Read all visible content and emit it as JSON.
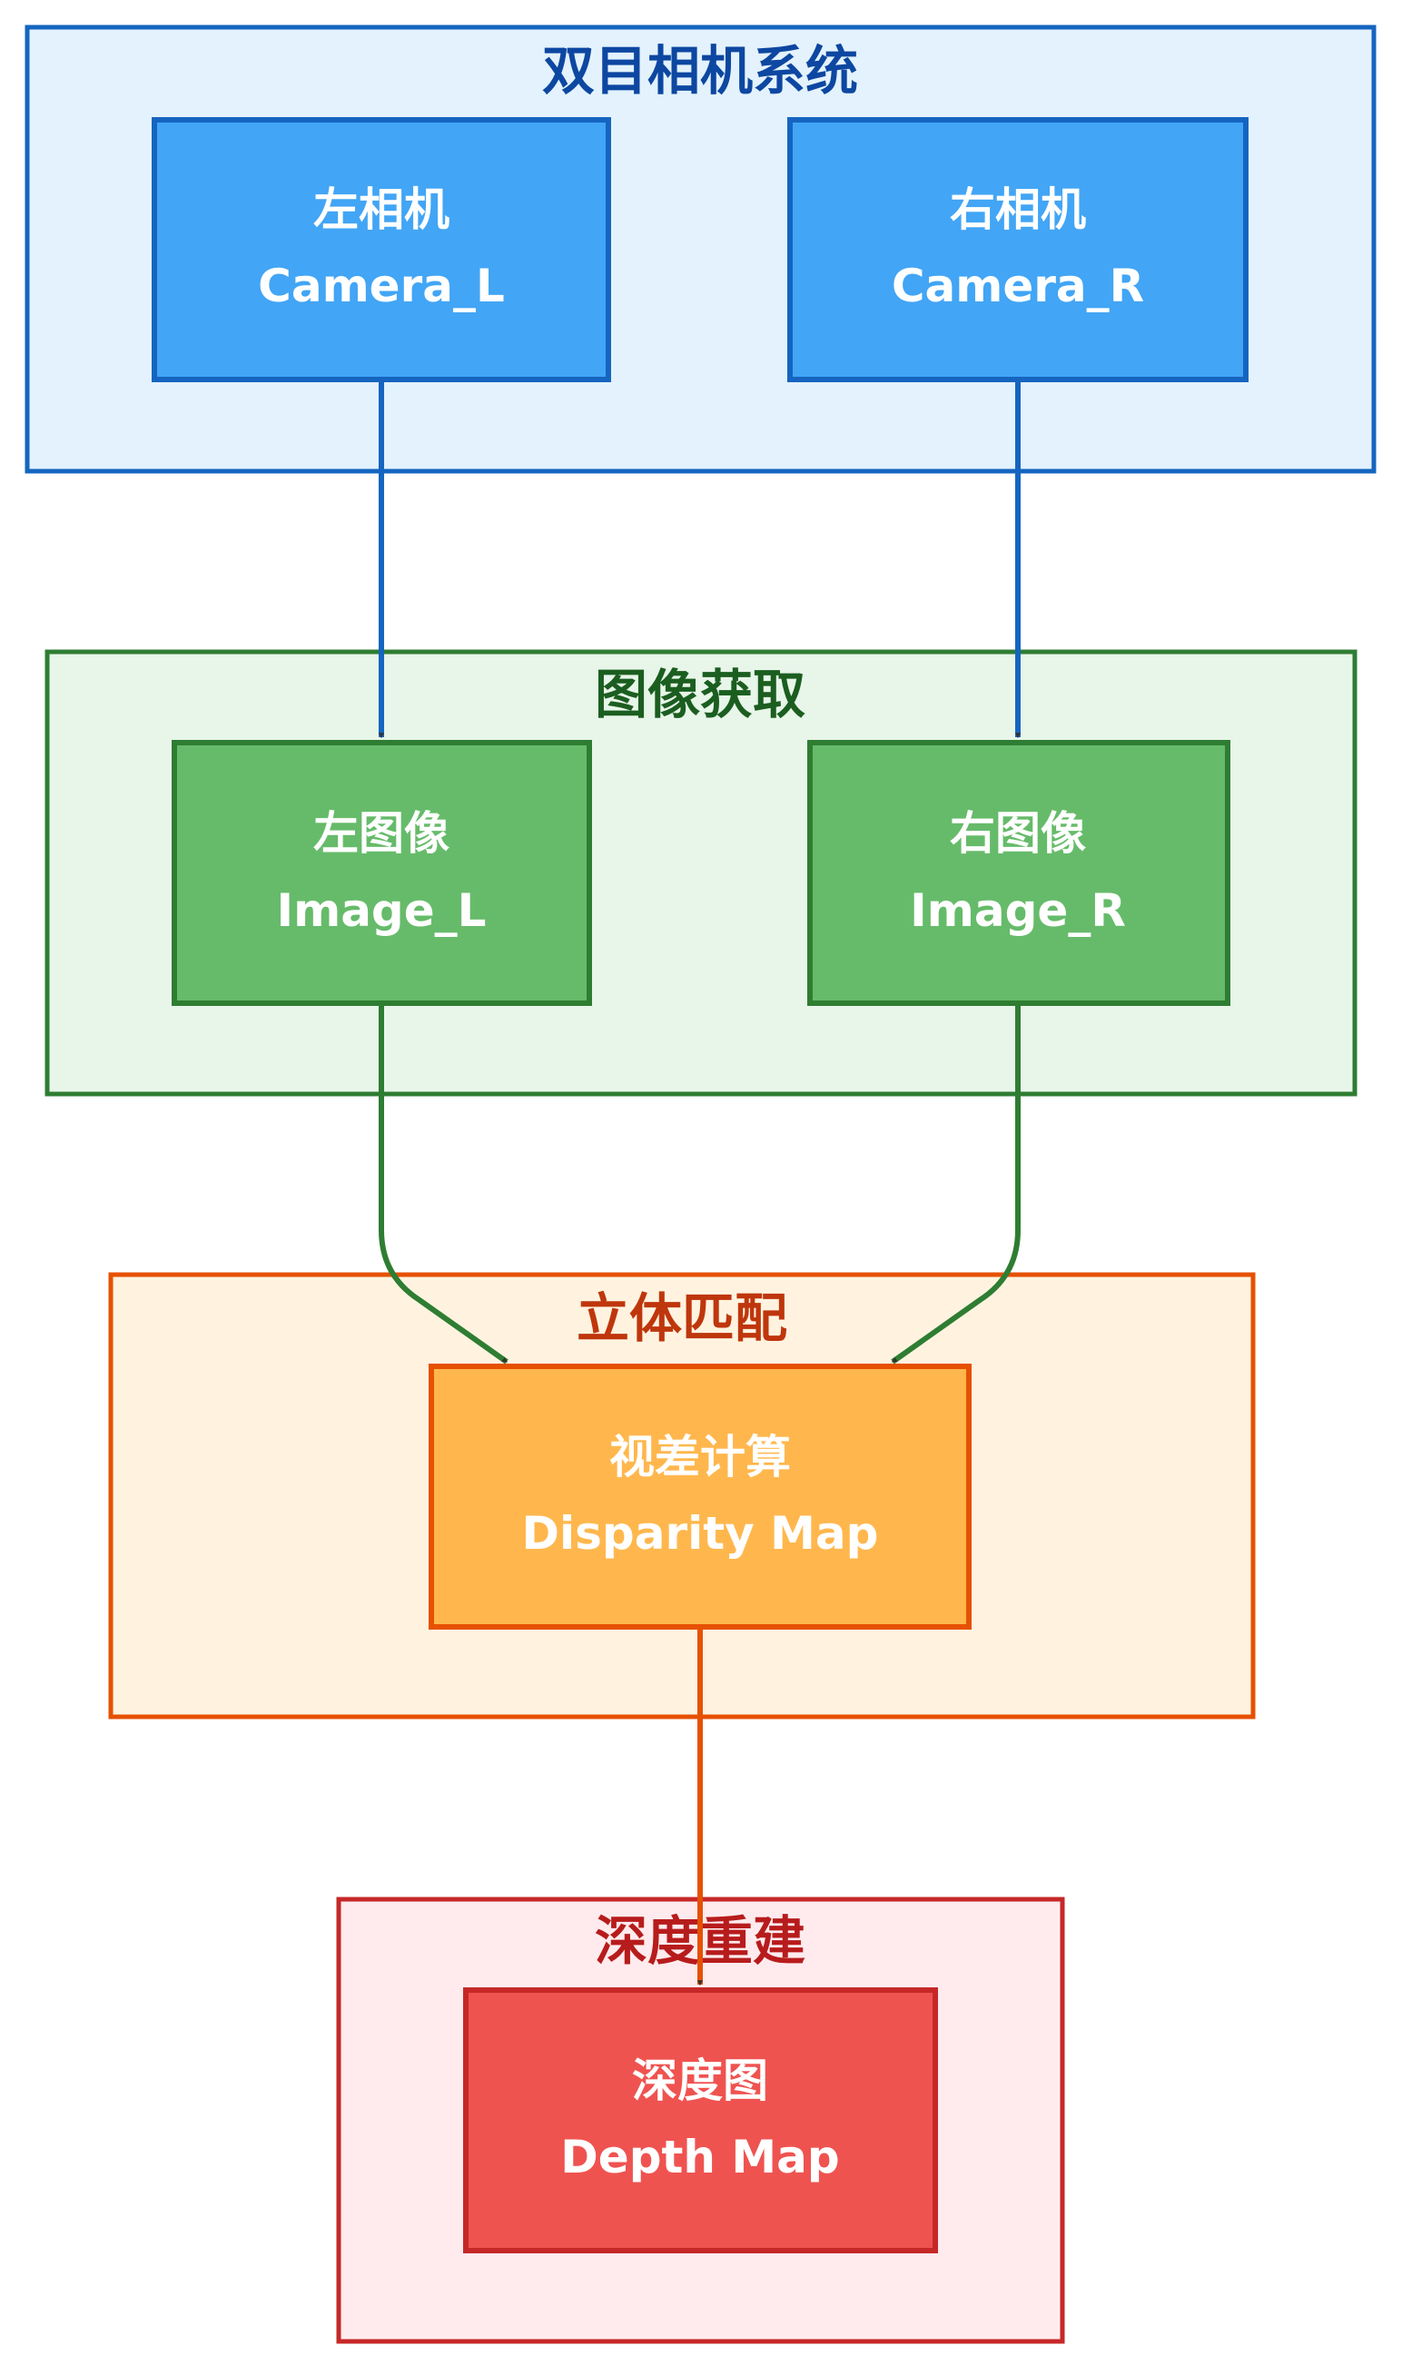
{
  "groups": [
    {
      "id": "camera_system",
      "title": "双目相机系统",
      "fill": "#e3f2fd",
      "stroke": "#1565c0",
      "title_color": "#0d47a1"
    },
    {
      "id": "image_capture",
      "title": "图像获取",
      "fill": "#e8f5e9",
      "stroke": "#2e7d32",
      "title_color": "#1b5e20"
    },
    {
      "id": "stereo_matching",
      "title": "立体匹配",
      "fill": "#fff3e0",
      "stroke": "#e65100",
      "title_color": "#bf360c"
    },
    {
      "id": "depth_reconstruction",
      "title": "深度重建",
      "fill": "#ffebee",
      "stroke": "#c62828",
      "title_color": "#b71c1c"
    }
  ],
  "nodes": [
    {
      "id": "camera_l",
      "line1": "左相机",
      "line2": "Camera_L",
      "fill": "#42a5f5",
      "stroke": "#1565c0"
    },
    {
      "id": "camera_r",
      "line1": "右相机",
      "line2": "Camera_R",
      "fill": "#42a5f5",
      "stroke": "#1565c0"
    },
    {
      "id": "image_l",
      "line1": "左图像",
      "line2": "Image_L",
      "fill": "#66bb6a",
      "stroke": "#2e7d32"
    },
    {
      "id": "image_r",
      "line1": "右图像",
      "line2": "Image_R",
      "fill": "#66bb6a",
      "stroke": "#2e7d32"
    },
    {
      "id": "disparity",
      "line1": "视差计算",
      "line2": "Disparity Map",
      "fill": "#ffb74d",
      "stroke": "#e65100"
    },
    {
      "id": "depth",
      "line1": "深度图",
      "line2": "Depth Map",
      "fill": "#ef5350",
      "stroke": "#c62828"
    }
  ],
  "edges": [
    {
      "from": "camera_l",
      "to": "image_l",
      "color": "#1565c0"
    },
    {
      "from": "camera_r",
      "to": "image_r",
      "color": "#1565c0"
    },
    {
      "from": "image_l",
      "to": "disparity",
      "color": "#2e7d32"
    },
    {
      "from": "image_r",
      "to": "disparity",
      "color": "#2e7d32"
    },
    {
      "from": "disparity",
      "to": "depth",
      "color": "#e65100"
    }
  ],
  "arrowhead_color": "#333333"
}
